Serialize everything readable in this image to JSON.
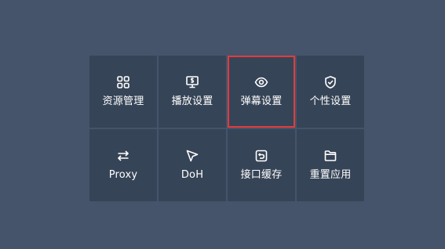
{
  "menu": {
    "items": [
      {
        "label": "资源管理",
        "icon": "grid-icon"
      },
      {
        "label": "播放设置",
        "icon": "monitor-dollar-icon"
      },
      {
        "label": "弹幕设置",
        "icon": "eye-icon",
        "selected": true
      },
      {
        "label": "个性设置",
        "icon": "shield-check-icon"
      },
      {
        "label": "Proxy",
        "icon": "swap-arrows-icon"
      },
      {
        "label": "DoH",
        "icon": "cursor-icon"
      },
      {
        "label": "接口缓存",
        "icon": "undo-box-icon"
      },
      {
        "label": "重置应用",
        "icon": "folder-icon"
      }
    ]
  },
  "colors": {
    "background": "#45546a",
    "tile": "#364457",
    "selection_border": "#e23b3b",
    "text": "#ffffff"
  }
}
